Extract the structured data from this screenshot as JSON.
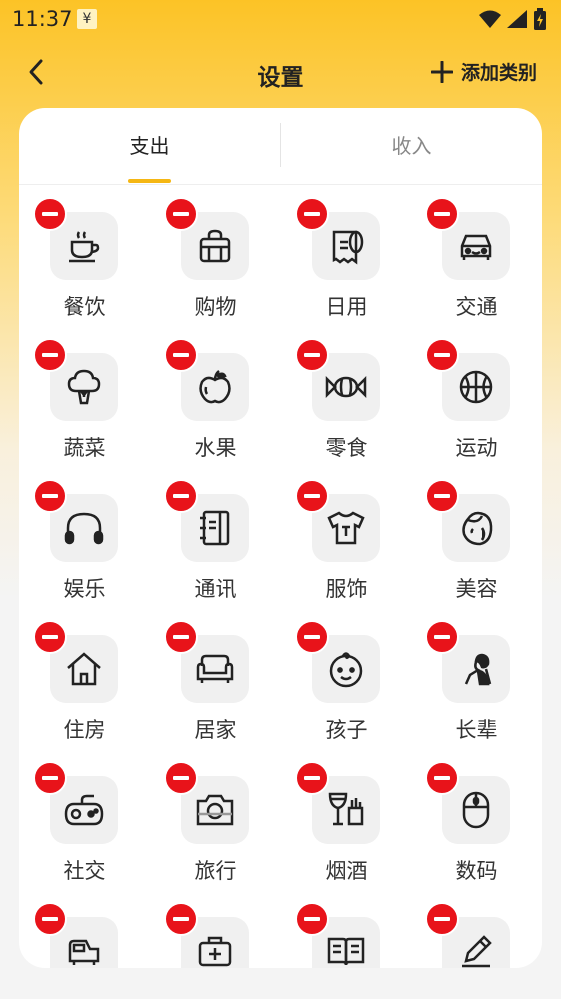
{
  "status_bar": {
    "time": "11:37",
    "notif_symbol": "¥"
  },
  "header": {
    "title": "设置",
    "add_label": "添加类别"
  },
  "tabs": [
    {
      "label": "支出",
      "active": true
    },
    {
      "label": "收入",
      "active": false
    }
  ],
  "categories": [
    {
      "label": "餐饮",
      "icon": "coffee-cup-icon"
    },
    {
      "label": "购物",
      "icon": "shopping-bag-icon"
    },
    {
      "label": "日用",
      "icon": "tissue-roll-icon"
    },
    {
      "label": "交通",
      "icon": "car-icon"
    },
    {
      "label": "蔬菜",
      "icon": "broccoli-icon"
    },
    {
      "label": "水果",
      "icon": "apple-icon"
    },
    {
      "label": "零食",
      "icon": "candy-icon"
    },
    {
      "label": "运动",
      "icon": "basketball-icon"
    },
    {
      "label": "娱乐",
      "icon": "headphones-icon"
    },
    {
      "label": "通讯",
      "icon": "address-book-icon"
    },
    {
      "label": "服饰",
      "icon": "tshirt-icon"
    },
    {
      "label": "美容",
      "icon": "beauty-face-icon"
    },
    {
      "label": "住房",
      "icon": "house-icon"
    },
    {
      "label": "居家",
      "icon": "sofa-icon"
    },
    {
      "label": "孩子",
      "icon": "baby-face-icon"
    },
    {
      "label": "长辈",
      "icon": "elder-icon"
    },
    {
      "label": "社交",
      "icon": "gamepad-icon"
    },
    {
      "label": "旅行",
      "icon": "camera-icon"
    },
    {
      "label": "烟酒",
      "icon": "wine-cigarette-icon"
    },
    {
      "label": "数码",
      "icon": "mouse-icon"
    },
    {
      "label": "",
      "icon": "vehicle-icon"
    },
    {
      "label": "",
      "icon": "medical-kit-icon"
    },
    {
      "label": "",
      "icon": "book-icon"
    },
    {
      "label": "",
      "icon": "pencil-icon"
    }
  ],
  "colors": {
    "accent": "#f5b714",
    "delete": "#e8131a",
    "header_bg": "#fcc326"
  }
}
